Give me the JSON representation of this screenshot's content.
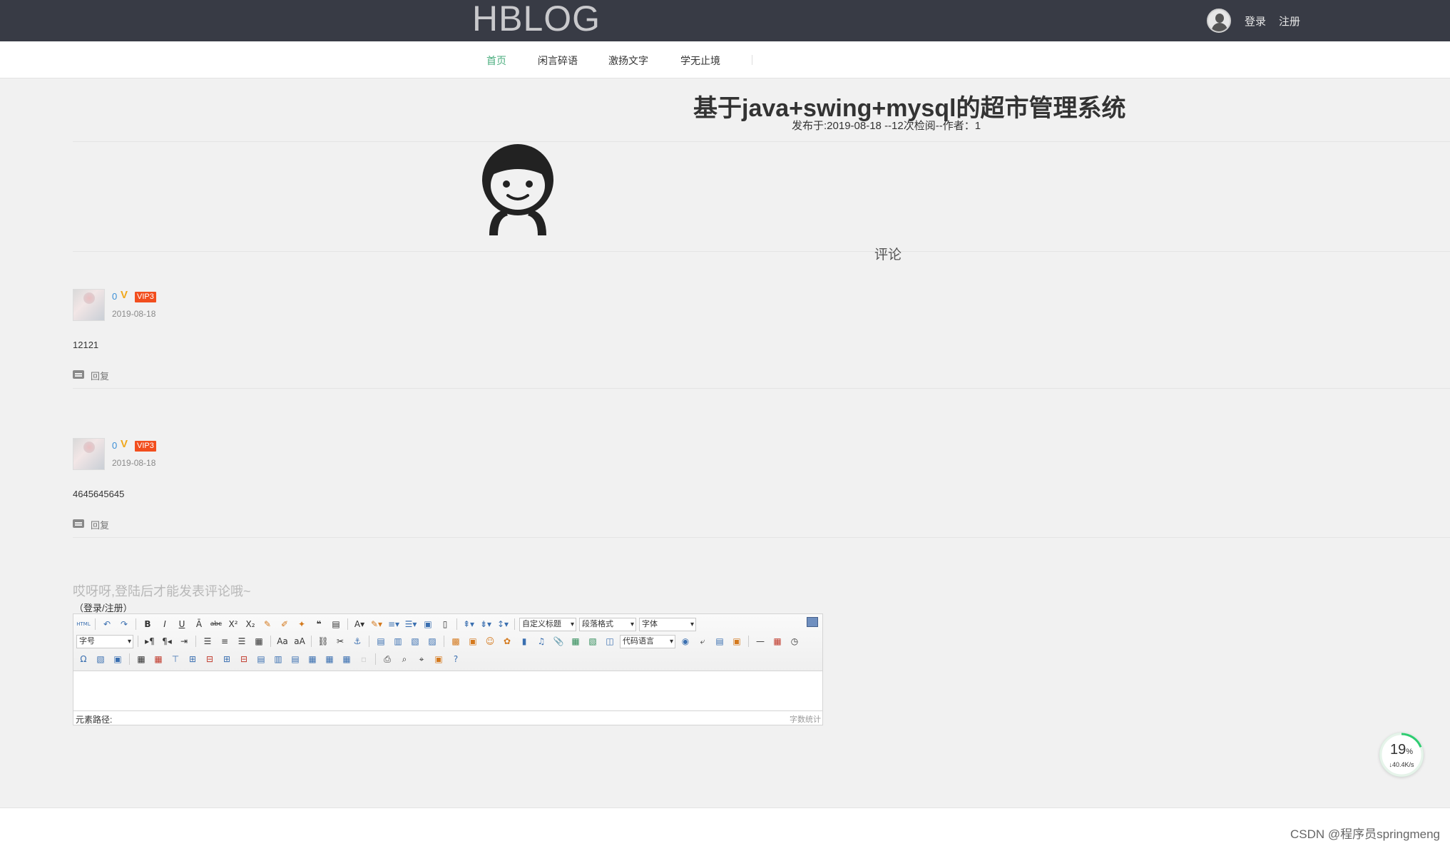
{
  "header": {
    "logo": "HBLOG",
    "login": "登录",
    "register": "注册"
  },
  "nav": {
    "items": [
      "首页",
      "闲言碎语",
      "激扬文字",
      "学无止境"
    ],
    "active": "首页"
  },
  "post": {
    "title": "基于java+swing+mysql的超市管理系统",
    "meta": "发布于:2019-08-18 --12次检阅--作者：1"
  },
  "comments_heading": "评论",
  "comments": [
    {
      "name": "0",
      "badge": "V",
      "vip": "VIP3",
      "date": "2019-08-18",
      "text": "12121",
      "reply": "回复"
    },
    {
      "name": "0",
      "badge": "V",
      "vip": "VIP3",
      "date": "2019-08-18",
      "text": "4645645645",
      "reply": "回复"
    }
  ],
  "login_hint": "哎呀呀,登陆后才能发表评论哦~",
  "login_link": "（登录/注册）",
  "editor": {
    "selects": {
      "custom_heading": "自定义标题",
      "paragraph": "段落格式",
      "font_family": "字体",
      "font_size": "字号",
      "code_lang": "代码语言"
    },
    "path_label": "元素路径:",
    "wordcount": "字数统计"
  },
  "network": {
    "percent": "19",
    "unit": "%",
    "speed": "↓40.4K/s",
    "accent": "#2ecc71"
  },
  "watermark": "CSDN @程序员springmeng"
}
